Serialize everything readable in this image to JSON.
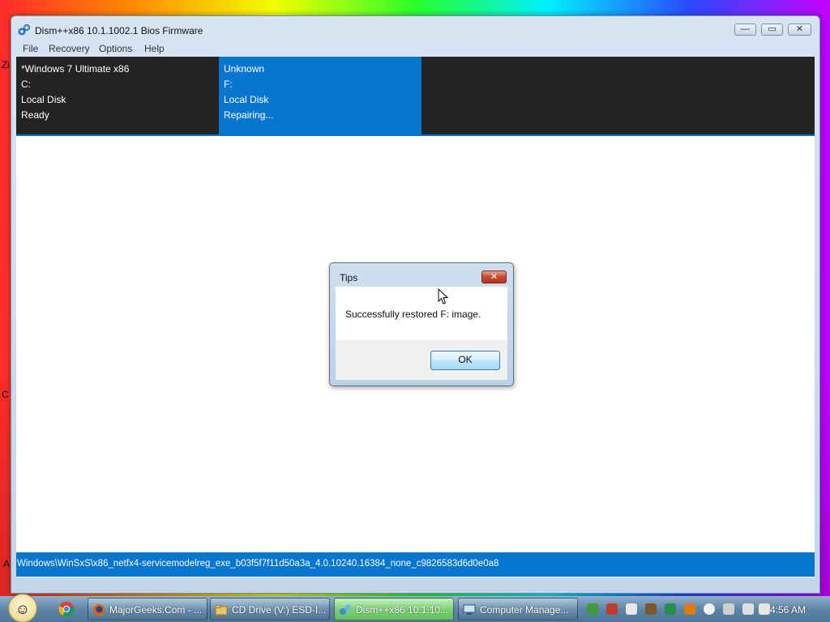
{
  "window": {
    "title": "Dism++x86 10.1.1002.1 Bios Firmware",
    "controls": {
      "minimize": "—",
      "maximize": "▭",
      "close": "✕"
    }
  },
  "menu": [
    "File",
    "Recovery",
    "Options",
    "Help"
  ],
  "disks": [
    {
      "name": "*Windows 7 Ultimate x86",
      "drive": "C:",
      "type": "Local Disk",
      "status": "Ready",
      "selected": false
    },
    {
      "name": "Unknown",
      "drive": "F:",
      "type": "Local Disk",
      "status": "Repairing...",
      "selected": true
    }
  ],
  "status_bar": {
    "path": "Windows\\WinSxS\\x86_netfx4-servicemodelreg_exe_b03f5f7f11d50a3a_4.0.10240.16384_none_c9826583d6d0e0a8"
  },
  "dialog": {
    "title": "Tips",
    "message": "Successfully restored F: image.",
    "ok_label": "OK",
    "close_glyph": "✕"
  },
  "desktop_fragments": {
    "left1": "Zi",
    "left2": "C",
    "left3": "A"
  },
  "taskbar": {
    "start_icon": "smiley-start-orb",
    "pinned": [
      "chrome-icon"
    ],
    "buttons": [
      {
        "label": "MajorGeeks.Com - ...",
        "icon": "firefox-icon",
        "active": false
      },
      {
        "label": "CD Drive (V:) ESD-I...",
        "icon": "folder-icon",
        "active": false
      },
      {
        "label": "Dism++x86 10.1.10...",
        "icon": "gears-icon",
        "active": true
      },
      {
        "label": "Computer Manage...",
        "icon": "computer-management-icon",
        "active": false
      }
    ],
    "clock": "4:56 AM"
  },
  "colors": {
    "accent": "#0875cf",
    "dark_panel": "#232323"
  }
}
